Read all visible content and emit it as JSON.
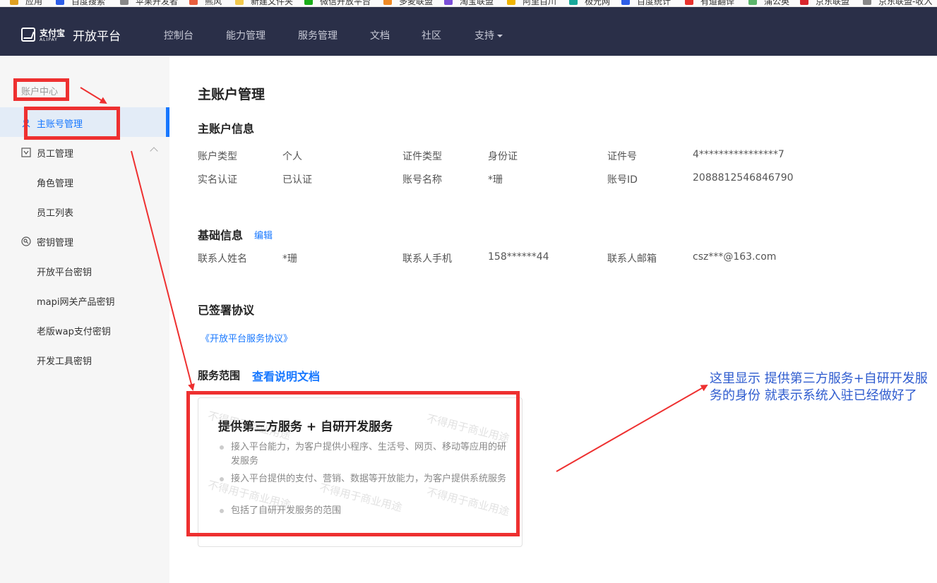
{
  "bookmarks": [
    "应用",
    "百度搜索",
    "苹果开发者",
    "熊风",
    "新建文件夹",
    "微信开放平台",
    "多麦联盟",
    "淘宝联盟",
    "阿里百川",
    "极光网",
    "百度统计",
    "有道翻译",
    "蒲公英",
    "京东联盟",
    "京东联盟-收入"
  ],
  "header": {
    "logo_name": "支付宝",
    "logo_sub": "ALIPAY",
    "title": "开放平台",
    "nav": [
      "控制台",
      "能力管理",
      "服务管理",
      "文档",
      "社区",
      "支持"
    ]
  },
  "sidebar": {
    "group_title": "账户中心",
    "items": [
      {
        "label": "主账号管理",
        "active": true
      },
      {
        "label": "员工管理",
        "expandable": true
      },
      {
        "label": "角色管理"
      },
      {
        "label": "员工列表"
      },
      {
        "label": "密钥管理",
        "expandable": true
      },
      {
        "label": "开放平台密钥"
      },
      {
        "label": "mapi网关产品密钥"
      },
      {
        "label": "老版wap支付密钥"
      },
      {
        "label": "开发工具密钥"
      }
    ]
  },
  "main": {
    "page_title": "主账户管理",
    "account_info": {
      "title": "主账户信息",
      "rows": [
        [
          {
            "label": "账户类型",
            "value": "个人"
          },
          {
            "label": "证件类型",
            "value": "身份证"
          },
          {
            "label": "证件号",
            "value": "4****************7"
          }
        ],
        [
          {
            "label": "实名认证",
            "value": "已认证"
          },
          {
            "label": "账号名称",
            "value": "*珊"
          },
          {
            "label": "账号ID",
            "value": "2088812546846790"
          }
        ]
      ]
    },
    "basic_info": {
      "title": "基础信息",
      "edit_label": "编辑",
      "fields": [
        {
          "label": "联系人姓名",
          "value": "*珊"
        },
        {
          "label": "联系人手机",
          "value": "158******44"
        },
        {
          "label": "联系人邮箱",
          "value": "csz***@163.com"
        }
      ]
    },
    "agreements": {
      "title": "已签署协议",
      "link": "《开放平台服务协议》"
    },
    "scope": {
      "title": "服务范围",
      "doc_link": "查看说明文档",
      "card_title": "提供第三方服务 + 自研开发服务",
      "bullets": [
        "接入平台能力，为客户提供小程序、生活号、网页、移动等应用的研发服务",
        "接入平台提供的支付、营销、数据等开放能力，为客户提供系统服务",
        "包括了自研开发服务的范围"
      ],
      "watermark": "不得用于商业用途"
    }
  },
  "annotation": {
    "note": "这里显示  提供第三方服务+自研开发服务的身份 就表示系统入驻已经做好了",
    "color": "#ee3030"
  },
  "colors": {
    "header_bg": "#2a2f48",
    "accent": "#1677ff",
    "sidebar_bg": "#f6f6f6"
  }
}
